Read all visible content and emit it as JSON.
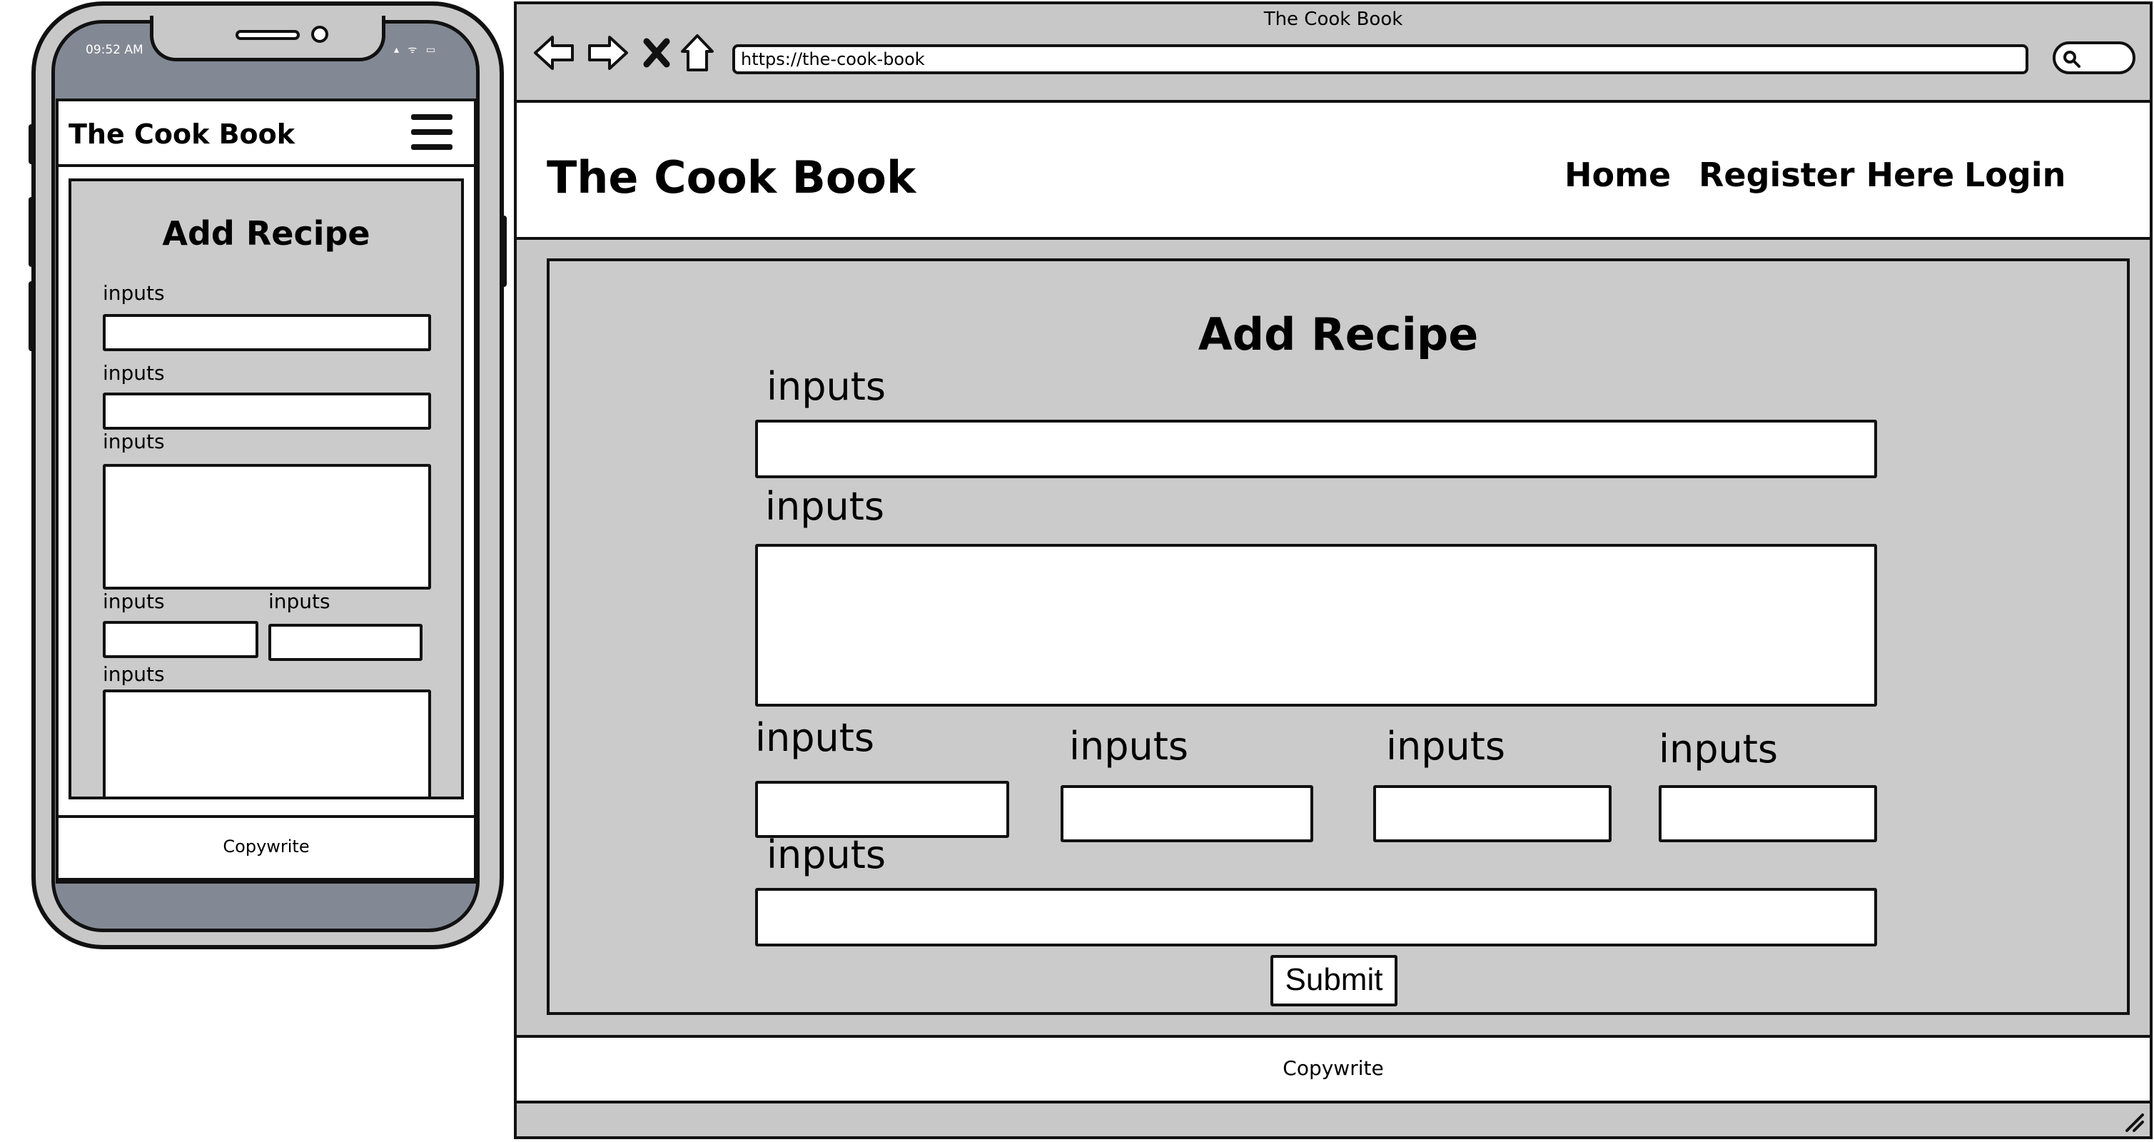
{
  "phone": {
    "status_time": "09:52 AM",
    "status_icons": "▴ ᯤ ▭",
    "brand": "The Cook Book",
    "form_title": "Add Recipe",
    "field_labels": [
      "inputs",
      "inputs",
      "inputs",
      "inputs",
      "inputs",
      "inputs"
    ],
    "footer": "Copywrite"
  },
  "browser": {
    "window_title": "The Cook Book",
    "url": "https://the-cook-book",
    "nav_icons": [
      "back-arrow-icon",
      "forward-arrow-icon",
      "close-x-icon",
      "home-icon",
      "search-icon"
    ],
    "brand": "The Cook Book",
    "nav": {
      "home": "Home",
      "register": "Register Here",
      "login": "Login"
    },
    "form_title": "Add Recipe",
    "field_labels": [
      "inputs",
      "inputs",
      "inputs",
      "inputs",
      "inputs",
      "inputs",
      "inputs"
    ],
    "submit_label": "Submit",
    "footer": "Copywrite"
  },
  "colors": {
    "frame_gray": "#c8c8c8",
    "card_gray": "#cbcbcb",
    "phone_statusbar": "#838994",
    "outline": "#111111",
    "surface": "#ffffff"
  }
}
